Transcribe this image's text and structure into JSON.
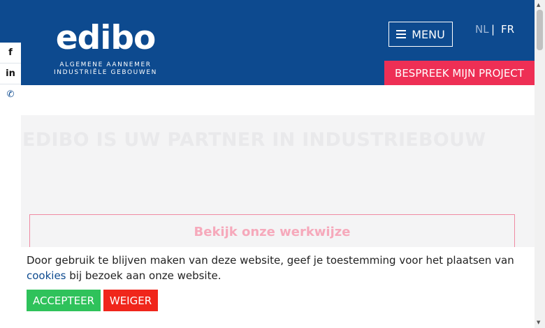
{
  "header": {
    "logo": {
      "word": "edibo",
      "line1": "ALGEMENE AANNEMER",
      "line2": "INDUSTRIËLE GEBOUWEN"
    },
    "menu_label": "MENU",
    "lang": {
      "nl": "NL",
      "sep": "|",
      "fr": "FR"
    },
    "cta_label": "BESPREEK MIJN PROJECT"
  },
  "social": [
    {
      "icon": "facebook-icon",
      "glyph": "f"
    },
    {
      "icon": "linkedin-icon",
      "glyph": "in"
    },
    {
      "icon": "phone-icon",
      "glyph": "✆"
    }
  ],
  "hero": {
    "title": "EDIBO IS UW PARTNER IN INDUSTRIEBOUW",
    "workflow_label": "Bekijk onze werkwijze"
  },
  "cookie": {
    "text_before": "Door gebruik te blijven maken van deze website, geef je toestemming voor het plaatsen van ",
    "link": "cookies",
    "text_after": " bij bezoek aan onze website.",
    "accept": "ACCEPTEER",
    "refuse": "WEIGER"
  },
  "colors": {
    "brand_blue": "#0d4a8f",
    "accent_pink": "#ee2f55",
    "accept_green": "#2fc25b",
    "refuse_red": "#f0261b"
  }
}
